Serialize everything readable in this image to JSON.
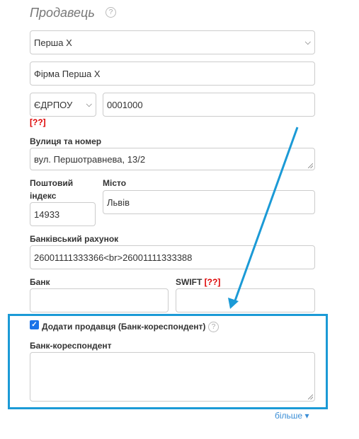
{
  "seller": {
    "title": "Продавець",
    "help_glyph": "?",
    "seller_select_value": "Перша Х",
    "company_name_value": "Фірма Перша Х",
    "id_type_value": "ЄДРПОУ",
    "id_number_value": "0001000",
    "id_warning": "[??]",
    "street_label": "Вулиця та номер",
    "street_value": "вул. Першотравнева, 13/2",
    "postal_label_line1": "Поштовий",
    "postal_label_line2": "індекс",
    "postal_value": "14933",
    "city_label": "Місто",
    "city_value": "Львів",
    "bank_account_label": "Банківський рахунок",
    "bank_account_value": "26001111333366<br>26001111333388",
    "bank_label": "Банк",
    "bank_value": "",
    "swift_label": "SWIFT",
    "swift_warning": "[??]",
    "swift_value": ""
  },
  "correspondent": {
    "checkbox_checked": true,
    "checkbox_label": "Додати продавця (Банк-кореспондент)",
    "field_label": "Банк-кореспондент",
    "field_value": ""
  },
  "more_link": {
    "label": "більше",
    "caret": "▾"
  },
  "colors": {
    "highlight": "#1b9ad6",
    "arrow": "#1b9ad6",
    "warning": "#dd0000",
    "link": "#3b8ed6"
  }
}
